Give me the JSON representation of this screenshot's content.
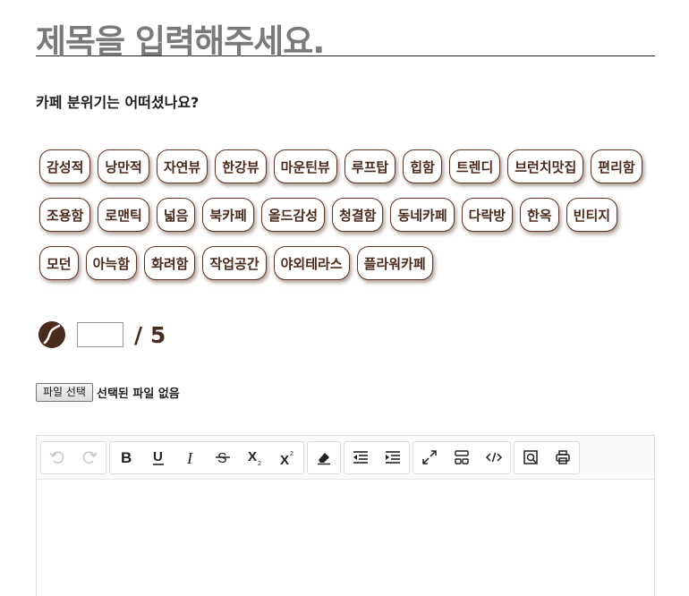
{
  "title_placeholder": "제목을 입력해주세요.",
  "question": "카페 분위기는 어떠셨나요?",
  "tags": [
    [
      "감성적",
      "낭만적",
      "자연뷰",
      "한강뷰",
      "마운틴뷰",
      "루프탑",
      "힙함",
      "트렌디",
      "브런치맛집",
      "편리함"
    ],
    [
      "조용함",
      "로맨틱",
      "넓음",
      "북카페",
      "올드감성",
      "청결함",
      "동네카페",
      "다락방",
      "한옥",
      "빈티지"
    ],
    [
      "모던",
      "아늑함",
      "화려함",
      "작업공간",
      "야외테라스",
      "플라워카페"
    ]
  ],
  "rating": {
    "value": "",
    "max_label": "/ 5",
    "icon": "coffee-bean-icon"
  },
  "file": {
    "button_label": "파일 선택",
    "status": "선택된 파일 없음"
  },
  "toolbar": {
    "groups": [
      [
        "undo-icon",
        "redo-icon"
      ],
      [
        "bold-icon",
        "underline-icon",
        "italic-icon",
        "strikethrough-icon",
        "subscript-icon",
        "superscript-icon"
      ],
      [
        "eraser-icon"
      ],
      [
        "outdent-icon",
        "indent-icon"
      ],
      [
        "fullscreen-icon",
        "show-blocks-icon",
        "code-view-icon"
      ],
      [
        "preview-icon",
        "print-icon"
      ]
    ]
  },
  "colors": {
    "brown": "#4a2a1c",
    "title_gray": "#7a7a7a"
  }
}
